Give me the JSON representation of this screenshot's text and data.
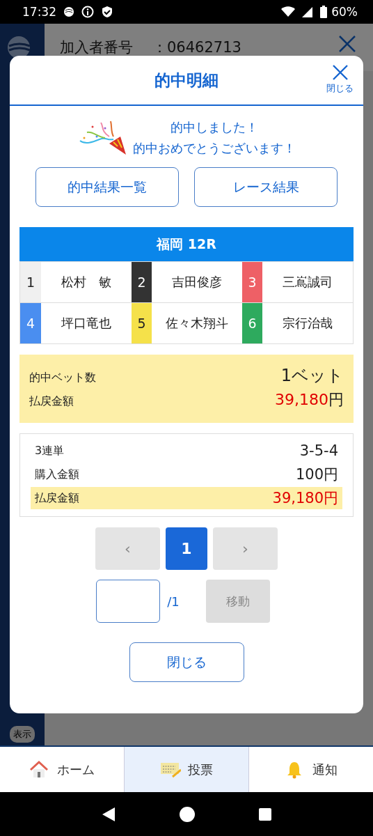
{
  "status_bar": {
    "time": "17:32",
    "battery": "60%"
  },
  "background": {
    "member_label": "加入者番号",
    "member_number": "：06462713",
    "badge": "表示"
  },
  "dialog": {
    "title": "的中明細",
    "close_label": "閉じる",
    "message": [
      "的中しました！",
      "的中おめでとうございます！"
    ],
    "links": [
      "的中結果一覧",
      "レース結果"
    ],
    "race": {
      "title": "福岡 12R",
      "racers": [
        {
          "number": "1",
          "name": "松村　敏",
          "color": "#f0f0f0"
        },
        {
          "number": "2",
          "name": "吉田俊彦",
          "color": "#333333"
        },
        {
          "number": "3",
          "name": "三嶌誠司",
          "color": "#ee6066"
        },
        {
          "number": "4",
          "name": "坪口竜也",
          "color": "#4a8ef0"
        },
        {
          "number": "5",
          "name": "佐々木翔斗",
          "color": "#f5e14a"
        },
        {
          "number": "6",
          "name": "宗行治哉",
          "color": "#2eaa5e"
        }
      ]
    },
    "summary": [
      {
        "label": "的中ベット数",
        "value": "1ベット"
      },
      {
        "label": "払戻金額",
        "value": "39,180",
        "unit": "円"
      }
    ],
    "detail": [
      {
        "label": "3連単",
        "value": "3-5-4",
        "highlight": false
      },
      {
        "label": "購入金額",
        "value": "100円",
        "highlight": false
      },
      {
        "label": "払戻金額",
        "value": "39,180円",
        "highlight": true
      }
    ],
    "pagination": {
      "prev": "‹",
      "next": "›",
      "pages": [
        {
          "label": "1",
          "selected": true
        }
      ],
      "total": "/1",
      "go": "移動"
    },
    "close_button": "閉じる"
  },
  "bottom_nav": [
    {
      "label": "ホーム",
      "kind": "home",
      "selected": false
    },
    {
      "label": "投票",
      "kind": "ticket",
      "selected": true
    },
    {
      "label": "通知",
      "kind": "bell",
      "selected": false
    }
  ]
}
